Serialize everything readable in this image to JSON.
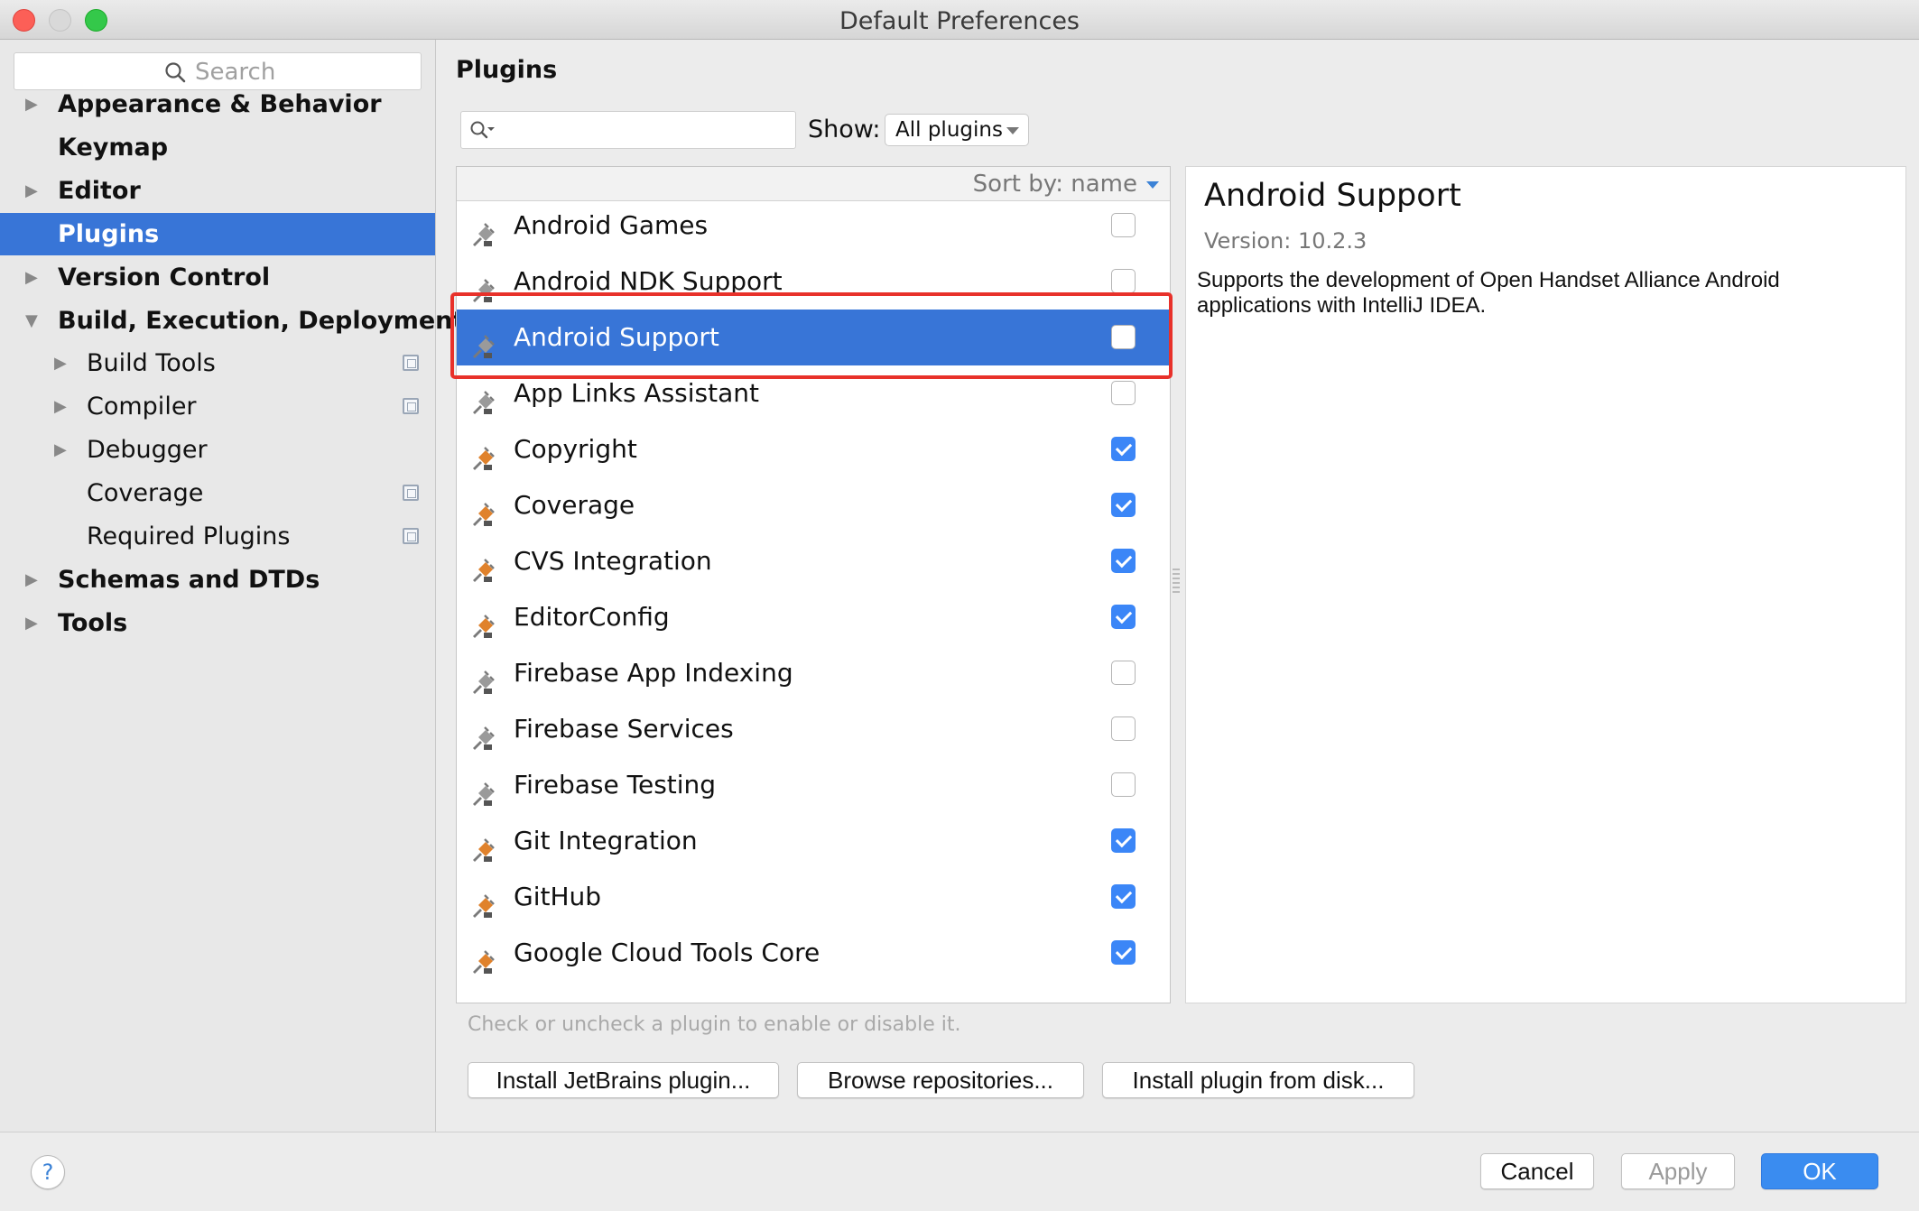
{
  "window": {
    "title": "Default Preferences"
  },
  "sidebar": {
    "search_placeholder": "Search",
    "items": [
      {
        "label": "Appearance & Behavior",
        "expandable": true,
        "expanded": false,
        "level": 0
      },
      {
        "label": "Keymap",
        "expandable": false,
        "level": 0
      },
      {
        "label": "Editor",
        "expandable": true,
        "expanded": false,
        "level": 0
      },
      {
        "label": "Plugins",
        "expandable": false,
        "level": 0,
        "selected": true
      },
      {
        "label": "Version Control",
        "expandable": true,
        "expanded": false,
        "level": 0
      },
      {
        "label": "Build, Execution, Deployment",
        "expandable": true,
        "expanded": true,
        "level": 0
      },
      {
        "label": "Build Tools",
        "expandable": true,
        "expanded": false,
        "level": 1,
        "project_icon": true
      },
      {
        "label": "Compiler",
        "expandable": true,
        "expanded": false,
        "level": 1,
        "project_icon": true
      },
      {
        "label": "Debugger",
        "expandable": true,
        "expanded": false,
        "level": 1
      },
      {
        "label": "Coverage",
        "expandable": false,
        "level": 1,
        "project_icon": true
      },
      {
        "label": "Required Plugins",
        "expandable": false,
        "level": 1,
        "project_icon": true
      },
      {
        "label": "Schemas and DTDs",
        "expandable": true,
        "expanded": false,
        "level": 0
      },
      {
        "label": "Tools",
        "expandable": true,
        "expanded": false,
        "level": 0
      }
    ]
  },
  "main": {
    "title": "Plugins",
    "filter_value": "",
    "show_label": "Show:",
    "show_value": "All plugins",
    "sort_label": "Sort by: name",
    "plugins": [
      {
        "name": "Android Games",
        "enabled": false
      },
      {
        "name": "Android NDK Support",
        "enabled": false
      },
      {
        "name": "Android Support",
        "enabled": false,
        "selected": true
      },
      {
        "name": "App Links Assistant",
        "enabled": false
      },
      {
        "name": "Copyright",
        "enabled": true
      },
      {
        "name": "Coverage",
        "enabled": true
      },
      {
        "name": "CVS Integration",
        "enabled": true
      },
      {
        "name": "EditorConfig",
        "enabled": true
      },
      {
        "name": "Firebase App Indexing",
        "enabled": false
      },
      {
        "name": "Firebase Services",
        "enabled": false
      },
      {
        "name": "Firebase Testing",
        "enabled": false
      },
      {
        "name": "Git Integration",
        "enabled": true
      },
      {
        "name": "GitHub",
        "enabled": true
      },
      {
        "name": "Google Cloud Tools Core",
        "enabled": true
      }
    ],
    "hint": "Check or uncheck a plugin to enable or disable it.",
    "buttons": {
      "install_jetbrains": "Install JetBrains plugin...",
      "browse": "Browse repositories...",
      "install_disk": "Install plugin from disk..."
    }
  },
  "detail": {
    "name": "Android Support",
    "version": "Version: 10.2.3",
    "description": "Supports the development of Open Handset Alliance Android applications with IntelliJ IDEA."
  },
  "footer": {
    "help": "?",
    "cancel": "Cancel",
    "apply": "Apply",
    "ok": "OK"
  },
  "colors": {
    "selection": "#3875d7",
    "checkbox_checked": "#3b86f7",
    "highlight_border": "#e8312a",
    "ok_button": "#3a8cf0",
    "plugin_icon_active": "#e0822c",
    "plugin_icon_inactive": "#9a9a9a"
  },
  "icons": {
    "search": "magnifier-icon",
    "plugin": "plug-icon",
    "tree_collapsed": "triangle-right-icon",
    "tree_expanded": "triangle-down-icon",
    "project_level": "project-settings-icon"
  }
}
